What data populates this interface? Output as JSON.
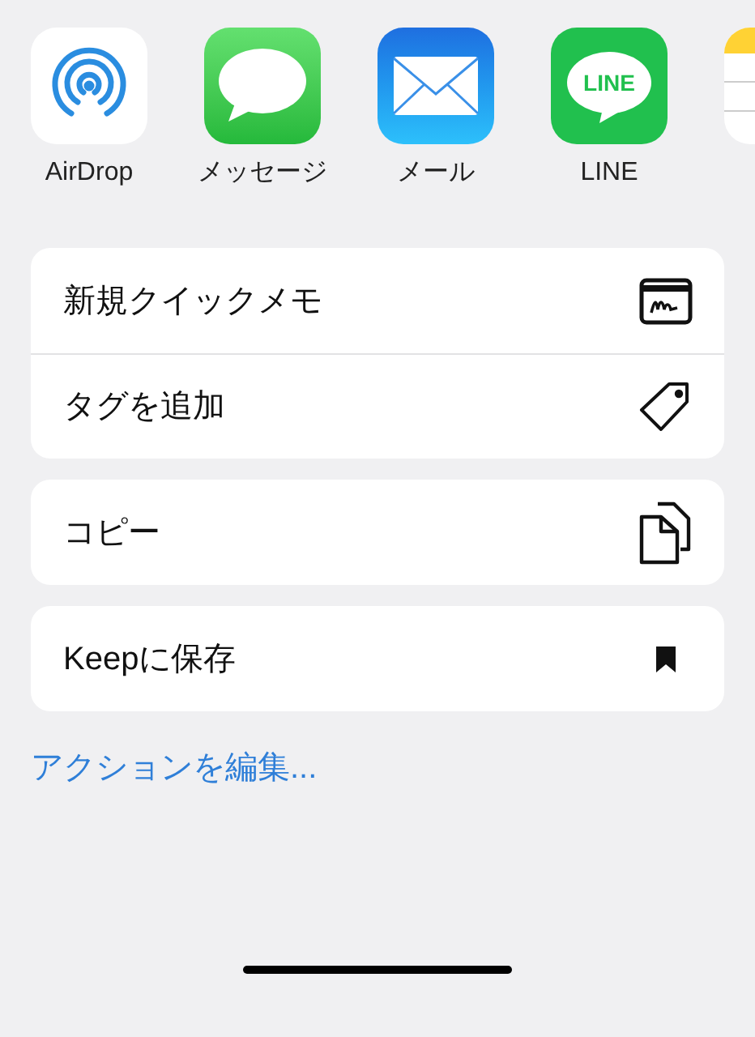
{
  "apps": [
    {
      "kind": "airdrop",
      "label": "AirDrop"
    },
    {
      "kind": "messages",
      "label": "メッセージ"
    },
    {
      "kind": "mail",
      "label": "メール"
    },
    {
      "kind": "line",
      "label": "LINE",
      "logo_text": "LINE"
    },
    {
      "kind": "notes"
    }
  ],
  "action_groups": [
    [
      {
        "kind": "quick-note",
        "label": "新規クイックメモ"
      },
      {
        "kind": "tag",
        "label": "タグを追加"
      }
    ],
    [
      {
        "kind": "copy",
        "label": "コピー"
      }
    ],
    [
      {
        "kind": "bookmark",
        "label": "Keepに保存"
      }
    ]
  ],
  "edit_actions_link": "アクションを編集..."
}
